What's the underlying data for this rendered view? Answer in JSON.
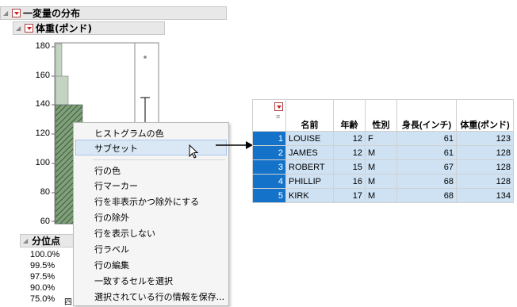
{
  "report": {
    "title": "一変量の分布",
    "variable": "体重(ポンド)",
    "y_axis_ticks": [
      "180",
      "160",
      "140",
      "120",
      "100",
      "80",
      "60"
    ],
    "quantiles_title": "分位点",
    "quantile_labels": [
      "100.0%",
      "99.5%",
      "97.5%",
      "90.0%",
      "75.0%"
    ],
    "quantile_suffix": "四"
  },
  "context_menu": {
    "items": [
      "ヒストグラムの色",
      "サブセット",
      "行の色",
      "行マーカー",
      "行を非表示かつ除外にする",
      "行の除外",
      "行を表示しない",
      "行ラベル",
      "行の編集",
      "一致するセルを選択",
      "選択されている行の情報を保存..."
    ],
    "highlighted": "サブセット"
  },
  "data_table": {
    "columns": [
      "名前",
      "年齢",
      "性別",
      "身長(インチ)",
      "体重(ポンド)"
    ],
    "rows": [
      {
        "n": "1",
        "cells": [
          "LOUISE",
          "12",
          "F",
          "61",
          "123"
        ]
      },
      {
        "n": "2",
        "cells": [
          "JAMES",
          "12",
          "M",
          "61",
          "128"
        ]
      },
      {
        "n": "3",
        "cells": [
          "ROBERT",
          "15",
          "M",
          "67",
          "128"
        ]
      },
      {
        "n": "4",
        "cells": [
          "PHILLIP",
          "16",
          "M",
          "68",
          "128"
        ]
      },
      {
        "n": "5",
        "cells": [
          "KIRK",
          "17",
          "M",
          "68",
          "134"
        ]
      }
    ]
  },
  "colors": {
    "selection_blue": "#1472c8",
    "cell_highlight": "#cfe2f3",
    "histogram_fill": "#c3d5c0",
    "histogram_hatched": "#5f7f5a"
  }
}
